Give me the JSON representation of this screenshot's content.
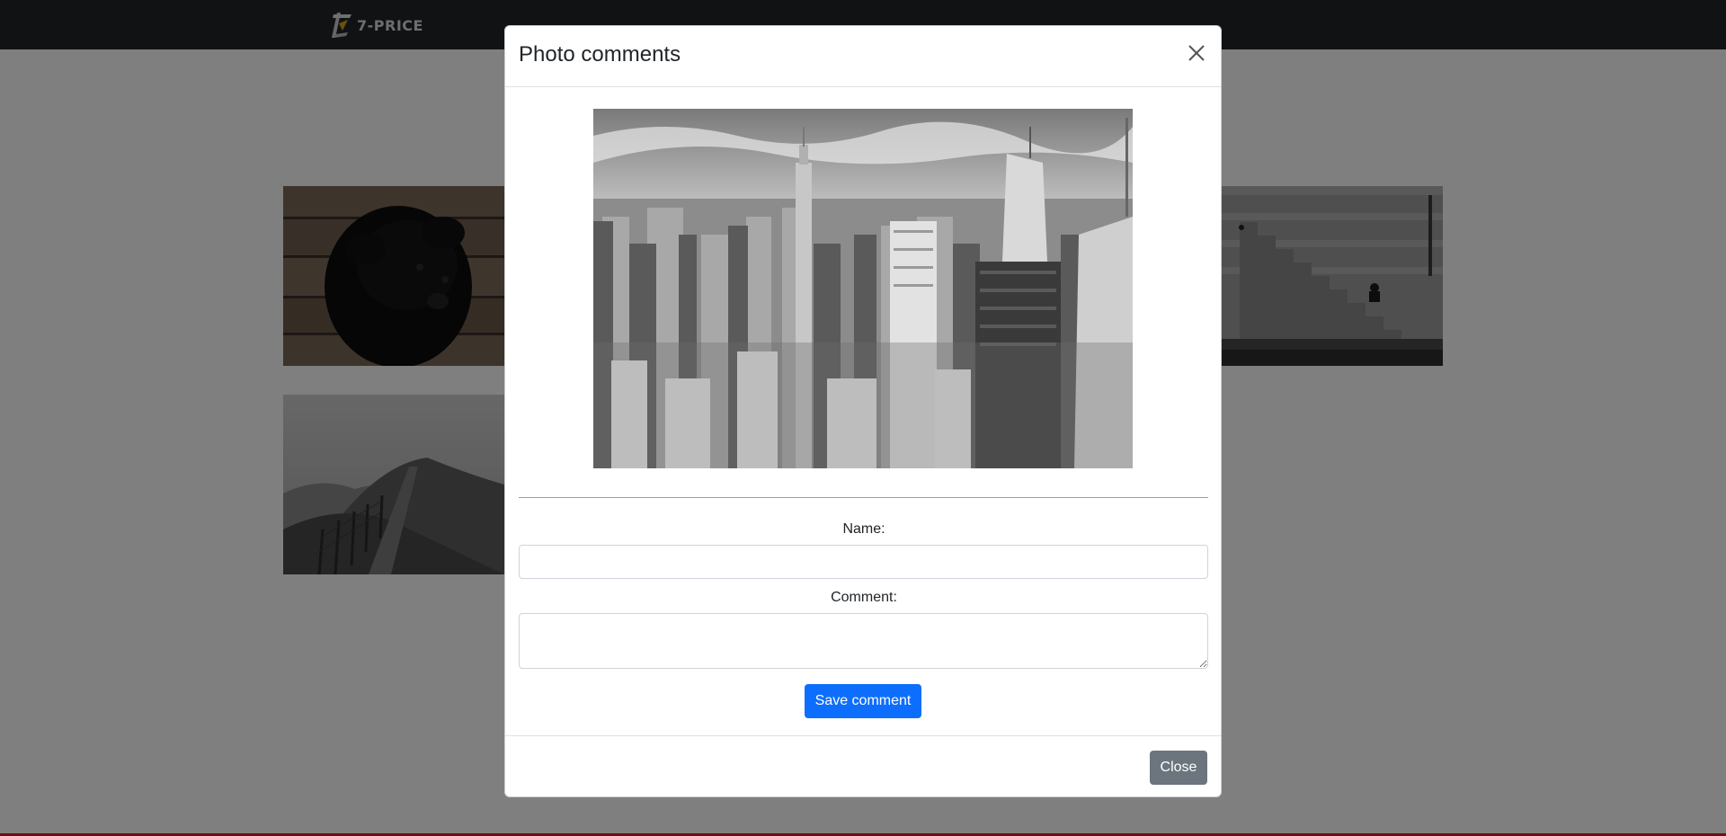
{
  "navbar": {
    "logo_text": "7-PRICE"
  },
  "modal": {
    "title": "Photo comments",
    "name_label": "Name:",
    "name_value": "",
    "comment_label": "Comment:",
    "comment_value": "",
    "save_label": "Save comment",
    "close_label": "Close",
    "photo_subject": "black-and-white aerial view of a city skyline"
  },
  "gallery": {
    "tiles": [
      {
        "subject": "black dog on wooden floor"
      },
      {
        "subject": "grassy hill path with fence"
      },
      {
        "subject": "person sitting on stone stairs by water"
      }
    ]
  },
  "colors": {
    "navbar_bg": "#212529",
    "primary_button": "#0d6efd",
    "secondary_button": "#6c757d"
  }
}
